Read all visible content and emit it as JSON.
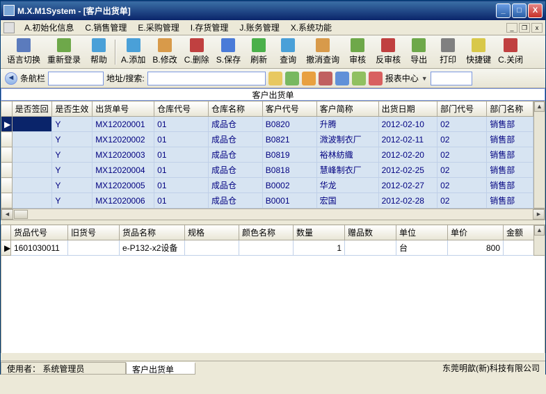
{
  "window": {
    "title": "M.X.M1System - [客户出货单]"
  },
  "menubar": {
    "items": [
      "A.初始化信息",
      "C.销售管理",
      "E.采购管理",
      "I.存货管理",
      "J.账务管理",
      "X.系统功能"
    ]
  },
  "toolbar": {
    "items": [
      {
        "label": "语言切换",
        "c": "#5b7bbd"
      },
      {
        "label": "重新登录",
        "c": "#6ea84a"
      },
      {
        "label": "帮助",
        "c": "#4aa0d8"
      },
      {
        "label": "A.添加",
        "c": "#4aa0d8"
      },
      {
        "label": "B.修改",
        "c": "#d89a4a"
      },
      {
        "label": "C.删除",
        "c": "#c04040"
      },
      {
        "label": "S.保存",
        "c": "#4a7bd8"
      },
      {
        "label": "刷新",
        "c": "#4ab04a"
      },
      {
        "label": "查询",
        "c": "#4aa0d8"
      },
      {
        "label": "撤消查询",
        "c": "#d89a4a"
      },
      {
        "label": "审核",
        "c": "#6ea84a"
      },
      {
        "label": "反审核",
        "c": "#c04040"
      },
      {
        "label": "导出",
        "c": "#6ea84a"
      },
      {
        "label": "打印",
        "c": "#808080"
      },
      {
        "label": "快捷键",
        "c": "#d8c84a"
      },
      {
        "label": "C.关闭",
        "c": "#c04040"
      }
    ]
  },
  "addrbar": {
    "nav_label": "条航栏",
    "addr_label": "地址/搜索:",
    "addr_value": "",
    "report_label": "报表中心"
  },
  "master": {
    "title": "客户出货单",
    "cols": [
      "是否签回",
      "是否生效",
      "出货单号",
      "仓库代号",
      "仓库名称",
      "客户代号",
      "客户简称",
      "出货日期",
      "部门代号",
      "部门名称"
    ],
    "rows": [
      {
        "signed": "",
        "effect": "Y",
        "no": "MX12020001",
        "whc": "01",
        "whn": "成品仓",
        "cc": "B0820",
        "cn": "升腾",
        "date": "2012-02-10",
        "dc": "02",
        "dn": "销售部"
      },
      {
        "signed": "",
        "effect": "Y",
        "no": "MX12020002",
        "whc": "01",
        "whn": "成品仓",
        "cc": "B0821",
        "cn": "溦波制衣厂",
        "date": "2012-02-11",
        "dc": "02",
        "dn": "销售部"
      },
      {
        "signed": "",
        "effect": "Y",
        "no": "MX12020003",
        "whc": "01",
        "whn": "成品仓",
        "cc": "B0819",
        "cn": "裕林紡織",
        "date": "2012-02-20",
        "dc": "02",
        "dn": "销售部"
      },
      {
        "signed": "",
        "effect": "Y",
        "no": "MX12020004",
        "whc": "01",
        "whn": "成品仓",
        "cc": "B0818",
        "cn": "慧峰制衣厂",
        "date": "2012-02-25",
        "dc": "02",
        "dn": "销售部"
      },
      {
        "signed": "",
        "effect": "Y",
        "no": "MX12020005",
        "whc": "01",
        "whn": "成品仓",
        "cc": "B0002",
        "cn": "华龙",
        "date": "2012-02-27",
        "dc": "02",
        "dn": "销售部"
      },
      {
        "signed": "",
        "effect": "Y",
        "no": "MX12020006",
        "whc": "01",
        "whn": "成品仓",
        "cc": "B0001",
        "cn": "宏国",
        "date": "2012-02-28",
        "dc": "02",
        "dn": "销售部"
      }
    ]
  },
  "detail": {
    "cols": [
      "货品代号",
      "旧货号",
      "货品名称",
      "规格",
      "颜色名称",
      "数量",
      "赠品数",
      "单位",
      "单价",
      "金额"
    ],
    "rows": [
      {
        "code": "1601030011",
        "old": "",
        "name": "e-P132-x2设备",
        "spec": "",
        "color": "",
        "qty": "1",
        "gift": "",
        "unit": "台",
        "price": "800",
        "amt": ""
      }
    ]
  },
  "status": {
    "user": "使用者： 系统管理员",
    "tab": "客户出货单",
    "company": "东莞明歆(新)科技有限公司"
  }
}
